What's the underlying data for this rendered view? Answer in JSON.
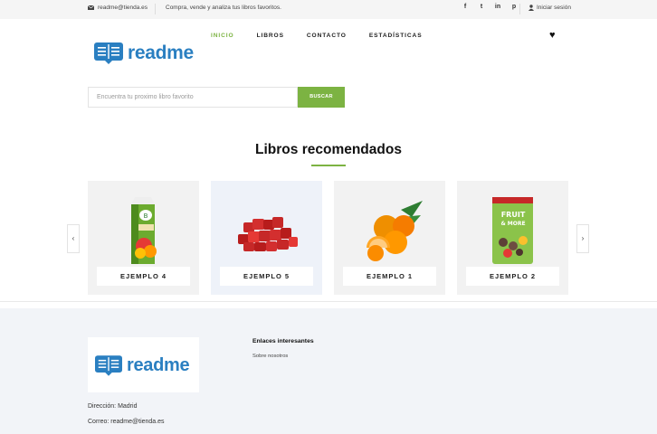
{
  "topbar": {
    "email": "readme@tienda.es",
    "tagline": "Compra, vende y analiza tus libros favoritos.",
    "social": [
      "f",
      "t",
      "in",
      "p"
    ],
    "login": "Iniciar sesión"
  },
  "header": {
    "logo_text": "readme",
    "nav": [
      {
        "label": "INICIO",
        "active": true
      },
      {
        "label": "LIBROS",
        "active": false
      },
      {
        "label": "CONTACTO",
        "active": false
      },
      {
        "label": "ESTADÍSTICAS",
        "active": false
      }
    ],
    "heart": "♥"
  },
  "search": {
    "placeholder": "Encuentra tu proximo libro favorito",
    "button_label": "BUSCAR"
  },
  "recommended": {
    "title": "Libros recomendados",
    "prev_arrow": "‹",
    "next_arrow": "›",
    "cards": [
      {
        "label": "EJEMPLO 4",
        "image": "juice-carton"
      },
      {
        "label": "EJEMPLO 5",
        "image": "raw-meat"
      },
      {
        "label": "EJEMPLO 1",
        "image": "oranges"
      },
      {
        "label": "EJEMPLO 2",
        "image": "fruit-snack-bag"
      }
    ]
  },
  "footer": {
    "logo_text": "readme",
    "links_heading": "Enlaces interesantes",
    "links": [
      "Sobre nosotros"
    ],
    "address": "Dirección: Madrid",
    "email_line": "Correo: readme@tienda.es"
  },
  "colors": {
    "accent": "#7cb342",
    "brand": "#2a7fc1",
    "footer_bg": "#f2f4f8"
  }
}
